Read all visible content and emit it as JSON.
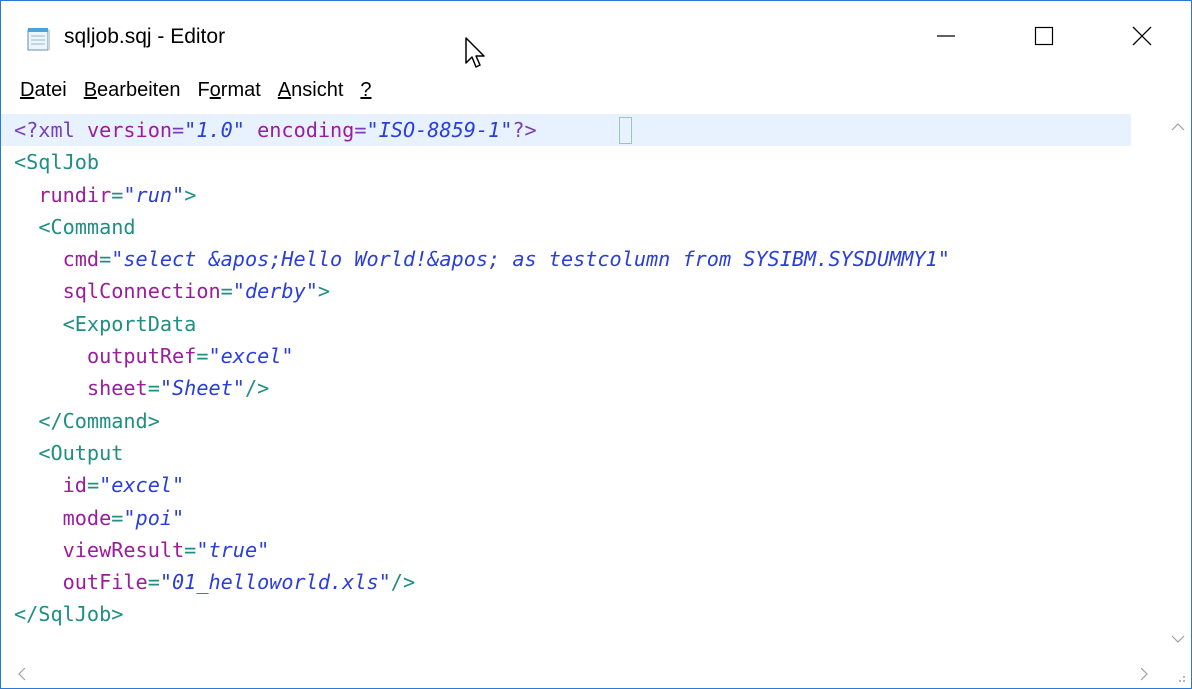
{
  "window": {
    "title": "sqljob.sqj - Editor"
  },
  "menu": [
    {
      "prefix": "",
      "key": "D",
      "rest": "atei"
    },
    {
      "prefix": "",
      "key": "B",
      "rest": "earbeiten"
    },
    {
      "prefix": "F",
      "key": "o",
      "rest": "rmat"
    },
    {
      "prefix": "",
      "key": "A",
      "rest": "nsicht"
    },
    {
      "prefix": "",
      "key": "?",
      "rest": ""
    }
  ],
  "code_lines": [
    [
      [
        "pi",
        "<?xml "
      ],
      [
        "attr",
        "version"
      ],
      [
        "pi",
        "="
      ],
      [
        "val",
        "\"1.0\""
      ],
      [
        "pi",
        " "
      ],
      [
        "attr",
        "encoding"
      ],
      [
        "pi",
        "="
      ],
      [
        "val",
        "\"ISO-8859-1\""
      ],
      [
        "pi",
        "?>"
      ]
    ],
    [
      [
        "tag",
        "<SqlJob"
      ]
    ],
    [
      [
        "plain",
        "  "
      ],
      [
        "attr",
        "rundir"
      ],
      [
        "tag",
        "="
      ],
      [
        "val",
        "\"run\""
      ],
      [
        "tag",
        ">"
      ]
    ],
    [
      [
        "plain",
        "  "
      ],
      [
        "tag",
        "<Command"
      ]
    ],
    [
      [
        "plain",
        "    "
      ],
      [
        "attr",
        "cmd"
      ],
      [
        "tag",
        "="
      ],
      [
        "val",
        "\"select &apos;Hello World!&apos; as testcolumn from SYSIBM.SYSDUMMY1\""
      ]
    ],
    [
      [
        "plain",
        "    "
      ],
      [
        "attr",
        "sqlConnection"
      ],
      [
        "tag",
        "="
      ],
      [
        "val",
        "\"derby\""
      ],
      [
        "tag",
        ">"
      ]
    ],
    [
      [
        "plain",
        "    "
      ],
      [
        "tag",
        "<ExportData"
      ]
    ],
    [
      [
        "plain",
        "      "
      ],
      [
        "attr",
        "outputRef"
      ],
      [
        "tag",
        "="
      ],
      [
        "val",
        "\"excel\""
      ]
    ],
    [
      [
        "plain",
        "      "
      ],
      [
        "attr",
        "sheet"
      ],
      [
        "tag",
        "="
      ],
      [
        "val",
        "\"Sheet\""
      ],
      [
        "tag",
        "/>"
      ]
    ],
    [
      [
        "plain",
        "  "
      ],
      [
        "tag",
        "</Command>"
      ]
    ],
    [
      [
        "plain",
        "  "
      ],
      [
        "tag",
        "<Output"
      ]
    ],
    [
      [
        "plain",
        "    "
      ],
      [
        "attr",
        "id"
      ],
      [
        "tag",
        "="
      ],
      [
        "val",
        "\"excel\""
      ]
    ],
    [
      [
        "plain",
        "    "
      ],
      [
        "attr",
        "mode"
      ],
      [
        "tag",
        "="
      ],
      [
        "val",
        "\"poi\""
      ]
    ],
    [
      [
        "plain",
        "    "
      ],
      [
        "attr",
        "viewResult"
      ],
      [
        "tag",
        "="
      ],
      [
        "val",
        "\"true\""
      ]
    ],
    [
      [
        "plain",
        "    "
      ],
      [
        "attr",
        "outFile"
      ],
      [
        "tag",
        "="
      ],
      [
        "val",
        "\"01_helloworld.xls\""
      ],
      [
        "tag",
        "/>"
      ]
    ],
    [
      [
        "tag",
        "</SqlJob>"
      ]
    ]
  ],
  "icons": {
    "app": "notepad-icon",
    "minimize": "minimize-icon",
    "maximize": "maximize-icon",
    "close": "close-icon"
  },
  "colors": {
    "tag": "#1f8f83",
    "attribute": "#9b1d9b",
    "value": "#2a3edb",
    "current_line": "#e8f2fe",
    "window_border": "#2b79d7"
  }
}
